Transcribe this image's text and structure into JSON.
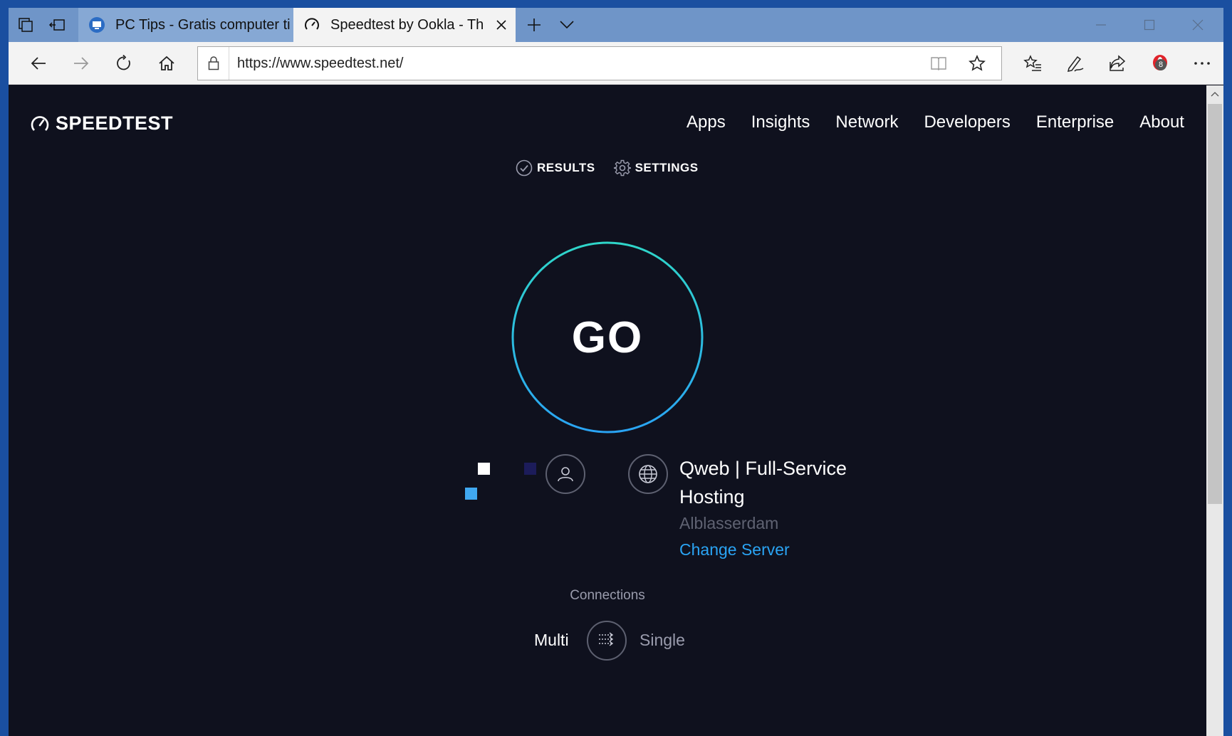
{
  "browser": {
    "tabs": [
      {
        "title": "PC Tips - Gratis computer ti",
        "active": false
      },
      {
        "title": "Speedtest by Ookla - Th",
        "active": true
      }
    ],
    "address": "https://www.speedtest.net/",
    "extension_badge": "8",
    "accent": "#1a4fa0"
  },
  "header": {
    "logo_text": "SPEEDTEST",
    "nav": [
      "Apps",
      "Insights",
      "Network",
      "Developers",
      "Enterprise",
      "About"
    ]
  },
  "subnav": {
    "results_label": "RESULTS",
    "settings_label": "SETTINGS"
  },
  "go_button": {
    "label": "GO",
    "ring_colors": [
      "#2fd6c9",
      "#2aa4f4"
    ]
  },
  "server": {
    "name": "Qweb | Full-Service Hosting",
    "location": "Alblasserdam",
    "change_label": "Change Server"
  },
  "connections": {
    "label": "Connections",
    "multi_label": "Multi",
    "single_label": "Single",
    "selected": "Multi"
  }
}
